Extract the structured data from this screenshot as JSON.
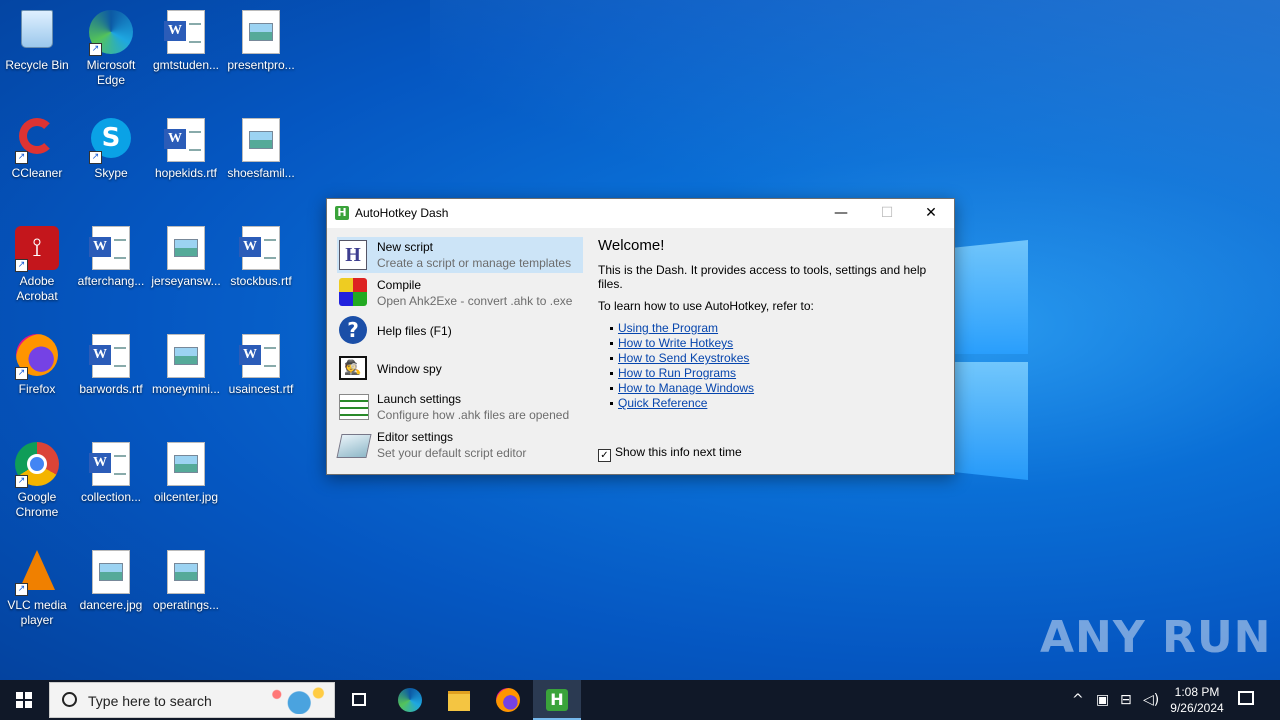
{
  "desktop": {
    "icons": [
      {
        "label": "Recycle Bin"
      },
      {
        "label": "Microsoft Edge"
      },
      {
        "label": "gmtstuden..."
      },
      {
        "label": "presentpro..."
      },
      {
        "label": "CCleaner"
      },
      {
        "label": "Skype"
      },
      {
        "label": "hopekids.rtf"
      },
      {
        "label": "shoesfamil..."
      },
      {
        "label": "Adobe Acrobat"
      },
      {
        "label": "afterchang..."
      },
      {
        "label": "jerseyansw..."
      },
      {
        "label": "stockbus.rtf"
      },
      {
        "label": "Firefox"
      },
      {
        "label": "barwords.rtf"
      },
      {
        "label": "moneymini..."
      },
      {
        "label": "usaincest.rtf"
      },
      {
        "label": "Google Chrome"
      },
      {
        "label": "collection..."
      },
      {
        "label": "oilcenter.jpg"
      },
      {
        "label": "VLC media player"
      },
      {
        "label": "dancere.jpg"
      },
      {
        "label": "operatings..."
      }
    ],
    "watermark": "ANY RUN"
  },
  "window": {
    "title": "AutoHotkey Dash",
    "app_icon": "H",
    "controls": {
      "minimize": "—",
      "maximize": "☐",
      "close": "✕"
    },
    "menu": [
      {
        "title": "New script",
        "subtitle": "Create a script or manage templates",
        "icon": "new-script-icon"
      },
      {
        "title": "Compile",
        "subtitle": "Open Ahk2Exe - convert .ahk to .exe",
        "icon": "compile-icon"
      },
      {
        "title": "Help files (F1)",
        "subtitle": "",
        "icon": "help-icon"
      },
      {
        "title": "Window spy",
        "subtitle": "",
        "icon": "spy-icon"
      },
      {
        "title": "Launch settings",
        "subtitle": "Configure how .ahk files are opened",
        "icon": "settings-list-icon"
      },
      {
        "title": "Editor settings",
        "subtitle": "Set your default script editor",
        "icon": "editor-icon"
      }
    ],
    "welcome": "Welcome!",
    "intro": "This is the Dash. It provides access to tools, settings and help files.",
    "learn": "To learn how to use AutoHotkey, refer to:",
    "links": [
      "Using the Program",
      "How to Write Hotkeys",
      "How to Send Keystrokes",
      "How to Run Programs",
      "How to Manage Windows",
      "Quick Reference"
    ],
    "show_info_label": "Show this info next time",
    "show_info_checked": true
  },
  "taskbar": {
    "search_placeholder": "Type here to search",
    "time": "1:08 PM",
    "date": "9/26/2024"
  }
}
